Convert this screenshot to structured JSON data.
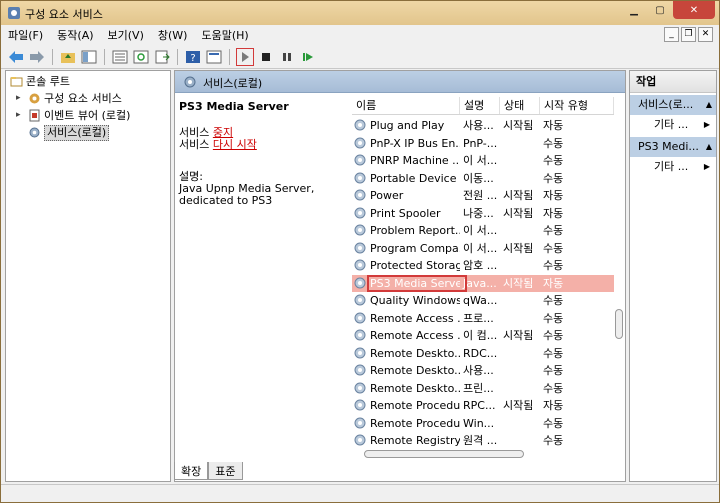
{
  "window": {
    "title": "구성 요소 서비스"
  },
  "menu": [
    "파일(F)",
    "동작(A)",
    "보기(V)",
    "창(W)",
    "도움말(H)"
  ],
  "tree": {
    "items": [
      {
        "label": "콘솔 루트",
        "level": 0,
        "expand": ""
      },
      {
        "label": "구성 요소 서비스",
        "level": 1,
        "expand": "▸"
      },
      {
        "label": "이벤트 뷰어 (로컬)",
        "level": 1,
        "expand": "▸"
      },
      {
        "label": "서비스(로컬)",
        "level": 1,
        "expand": ""
      }
    ]
  },
  "main": {
    "header": "서비스(로컬)",
    "service_name": "PS3 Media Server",
    "stop_prefix": "서비스 ",
    "stop_link": "중지",
    "restart_prefix": "서비스 ",
    "restart_link": "다시 시작",
    "desc_label": "설명:",
    "desc_line1": "Java Upnp Media Server,",
    "desc_line2": "dedicated to PS3"
  },
  "list": {
    "columns": [
      "이름",
      "설명",
      "상태",
      "시작 유형"
    ],
    "rows": [
      {
        "name": "Plug and Play",
        "desc": "사용...",
        "status": "시작됨",
        "start": "자동"
      },
      {
        "name": "PnP-X IP Bus En...",
        "desc": "PnP-...",
        "status": "",
        "start": "수동"
      },
      {
        "name": "PNRP Machine ...",
        "desc": "이 서...",
        "status": "",
        "start": "수동"
      },
      {
        "name": "Portable Device ...",
        "desc": "이동...",
        "status": "",
        "start": "수동"
      },
      {
        "name": "Power",
        "desc": "전원 ...",
        "status": "시작됨",
        "start": "자동"
      },
      {
        "name": "Print Spooler",
        "desc": "나중...",
        "status": "시작됨",
        "start": "자동"
      },
      {
        "name": "Problem Report...",
        "desc": "이 서...",
        "status": "",
        "start": "수동"
      },
      {
        "name": "Program Compa...",
        "desc": "이 서...",
        "status": "시작됨",
        "start": "수동"
      },
      {
        "name": "Protected Storage",
        "desc": "암호 ...",
        "status": "",
        "start": "수동"
      },
      {
        "name": "PS3 Media Server",
        "desc": "Java...",
        "status": "시작됨",
        "start": "자동",
        "selected": true
      },
      {
        "name": "Quality Windows...",
        "desc": "qWa...",
        "status": "",
        "start": "수동"
      },
      {
        "name": "Remote Access ...",
        "desc": "프로...",
        "status": "",
        "start": "수동"
      },
      {
        "name": "Remote Access ...",
        "desc": "이 컴...",
        "status": "시작됨",
        "start": "수동"
      },
      {
        "name": "Remote Deskto...",
        "desc": "RDC...",
        "status": "",
        "start": "수동"
      },
      {
        "name": "Remote Deskto...",
        "desc": "사용...",
        "status": "",
        "start": "수동"
      },
      {
        "name": "Remote Deskto...",
        "desc": "프린...",
        "status": "",
        "start": "수동"
      },
      {
        "name": "Remote Procedu...",
        "desc": "RPC...",
        "status": "시작됨",
        "start": "자동"
      },
      {
        "name": "Remote Procedu...",
        "desc": "Win...",
        "status": "",
        "start": "수동"
      },
      {
        "name": "Remote Registry",
        "desc": "원격 ...",
        "status": "",
        "start": "수동"
      }
    ]
  },
  "tabs": [
    "확장",
    "표준"
  ],
  "actions": {
    "title": "작업",
    "group1": "서비스(로...",
    "group1_item": "기타 ...",
    "group2": "PS3 Medi...",
    "group2_item": "기타 ..."
  },
  "colors": {
    "title_bar": "#e2c58c",
    "header_blue": "#a6bcd6",
    "selected_row": "#f4b0a8",
    "highlight_border": "#d23a3a"
  }
}
